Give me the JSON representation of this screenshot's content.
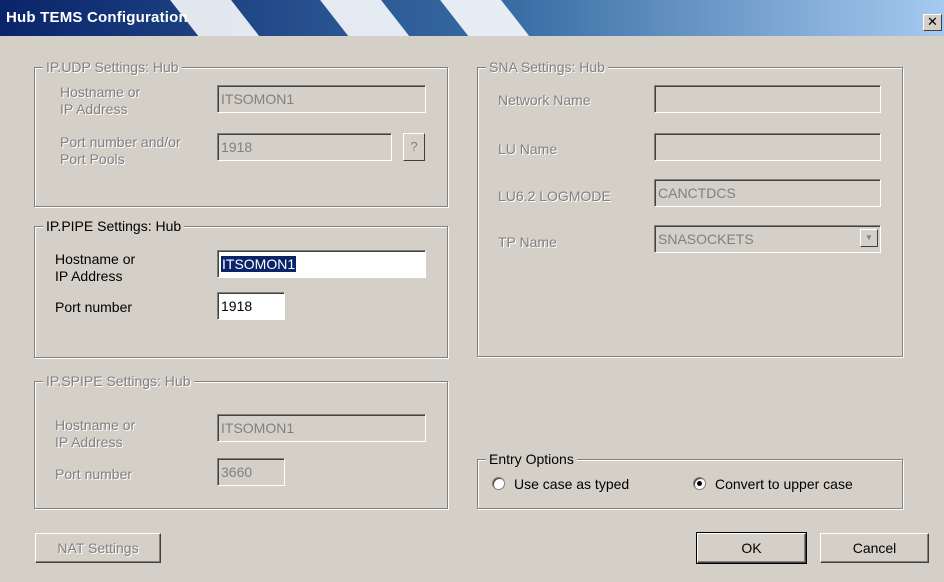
{
  "window": {
    "title": "Hub TEMS Configuration",
    "close_glyph": "✕"
  },
  "ipudp": {
    "legend": "IP.UDP Settings: Hub",
    "host_label_1": "Hostname or",
    "host_label_2": "IP Address",
    "host_value": "ITSOMON1",
    "port_label_1": "Port number and/or",
    "port_label_2": "Port Pools",
    "port_value": "1918",
    "help_label": "?"
  },
  "ippipe": {
    "legend": "IP.PIPE Settings: Hub",
    "host_label_1": "Hostname or",
    "host_label_2": "IP Address",
    "host_value": "ITSOMON1",
    "port_label": "Port number",
    "port_value": "1918"
  },
  "ipspipe": {
    "legend": "IP.SPIPE Settings: Hub",
    "host_label_1": "Hostname or",
    "host_label_2": "IP Address",
    "host_value": "ITSOMON1",
    "port_label": "Port number",
    "port_value": "3660"
  },
  "sna": {
    "legend": "SNA Settings: Hub",
    "network_label": "Network Name",
    "network_value": "",
    "lu_label": "LU Name",
    "lu_value": "",
    "logmode_label": "LU6.2 LOGMODE",
    "logmode_value": "CANCTDCS",
    "tp_label": "TP Name",
    "tp_value": "SNASOCKETS"
  },
  "entry_options": {
    "legend": "Entry Options",
    "option_typed": "Use case as typed",
    "option_upper": "Convert to upper case",
    "selected": "upper"
  },
  "buttons": {
    "nat": "NAT Settings",
    "ok": "OK",
    "cancel": "Cancel"
  }
}
